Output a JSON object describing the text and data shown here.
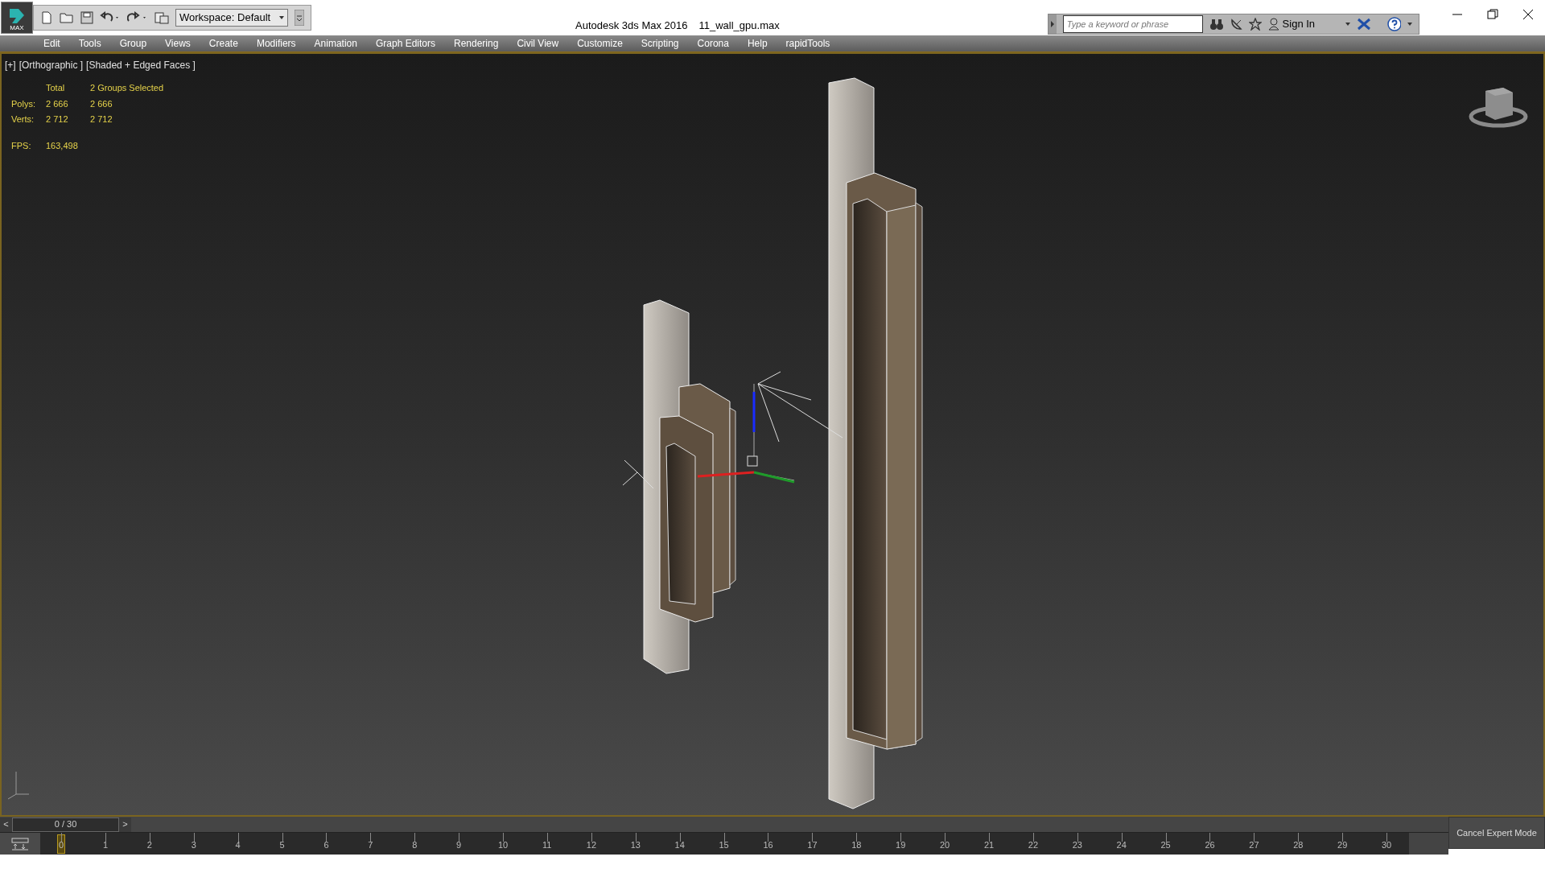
{
  "title_bar": {
    "logo_label": "MAX",
    "workspace": "Workspace: Default",
    "app_title": "Autodesk 3ds Max 2016",
    "file_name": "11_wall_gpu.max",
    "search": {
      "placeholder": "Type a keyword or phrase"
    },
    "sign_in": "Sign In"
  },
  "menu": [
    "Edit",
    "Tools",
    "Group",
    "Views",
    "Create",
    "Modifiers",
    "Animation",
    "Graph Editors",
    "Rendering",
    "Civil View",
    "Customize",
    "Scripting",
    "Corona",
    "Help",
    "rapidTools"
  ],
  "viewport": {
    "labels": [
      "[+]",
      "[Orthographic ]",
      "[Shaded + Edged Faces ]"
    ],
    "stats": {
      "header": [
        "Total",
        "2 Groups Selected"
      ],
      "rows": [
        {
          "label": "Polys:",
          "total": "2 666",
          "selected": "2 666"
        },
        {
          "label": "Verts:",
          "total": "2 712",
          "selected": "2 712"
        }
      ],
      "fps_label": "FPS:",
      "fps": "163,498"
    }
  },
  "time_slider": {
    "prev": "<",
    "frame": "0 / 30",
    "next": ">",
    "level": 0
  },
  "track_bar": {
    "ticks": [
      "0",
      "1",
      "2",
      "3",
      "4",
      "5",
      "6",
      "7",
      "8",
      "9",
      "10",
      "11",
      "12",
      "13",
      "14",
      "15",
      "16",
      "17",
      "18",
      "19",
      "20",
      "21",
      "22",
      "23",
      "24",
      "25",
      "26",
      "27",
      "28",
      "29",
      "30"
    ]
  },
  "cancel_expert_mode": "Cancel Expert Mode"
}
